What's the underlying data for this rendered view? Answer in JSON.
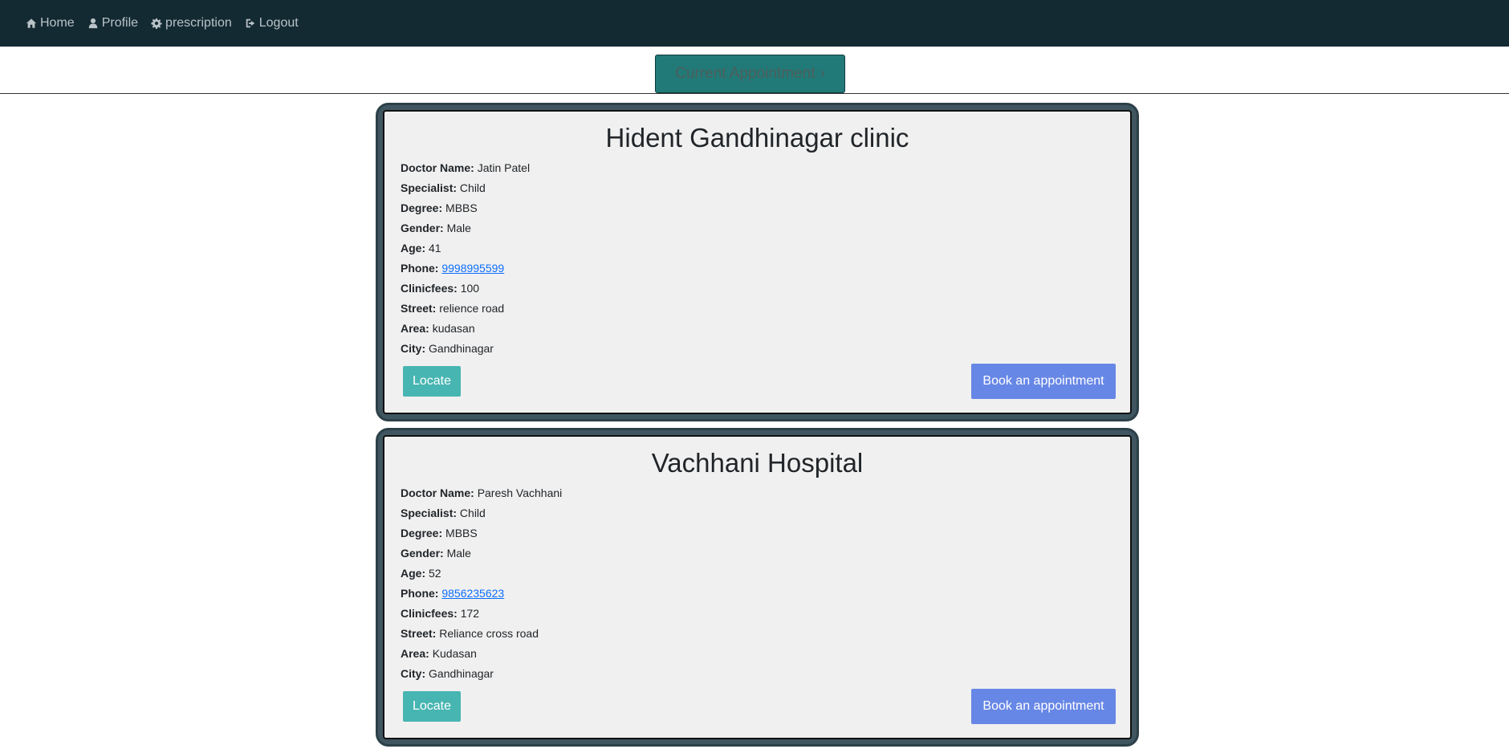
{
  "nav": {
    "items": [
      {
        "label": "Home",
        "icon": "home-icon"
      },
      {
        "label": "Profile",
        "icon": "user-icon"
      },
      {
        "label": "prescription",
        "icon": "gear-icon"
      },
      {
        "label": "Logout",
        "icon": "logout-icon"
      }
    ]
  },
  "current_appointment": {
    "label": "Current Appointment",
    "icon": "chevron-right-icon"
  },
  "labels": {
    "doctor_name": "Doctor Name:",
    "specialist": "Specialist:",
    "degree": "Degree:",
    "gender": "Gender:",
    "age": "Age:",
    "phone": "Phone:",
    "clinicfees": "Clinicfees:",
    "street": "Street:",
    "area": "Area:",
    "city": "City:"
  },
  "clinics": [
    {
      "name": "Hident Gandhinagar clinic",
      "doctor_name": "Jatin Patel",
      "specialist": "Child",
      "degree": "MBBS",
      "gender": "Male",
      "age": "41",
      "phone": "9998995599",
      "clinicfees": "100",
      "street": "relience road",
      "area": "kudasan",
      "city": "Gandhinagar",
      "locate_label": "Locate",
      "book_label": "Book an appointment"
    },
    {
      "name": "Vachhani Hospital",
      "doctor_name": "Paresh Vachhani",
      "specialist": "Child",
      "degree": "MBBS",
      "gender": "Male",
      "age": "52",
      "phone": "9856235623",
      "clinicfees": "172",
      "street": "Reliance cross road",
      "area": "Kudasan",
      "city": "Gandhinagar",
      "locate_label": "Locate",
      "book_label": "Book an appointment"
    }
  ],
  "colors": {
    "navbar": "#142a33",
    "nav_text": "#b9c3c8",
    "current_button": "#217a78",
    "card_border": "#3f5660",
    "card_bg": "#f0f0f0",
    "locate_button": "#47b5b1",
    "book_button": "#6787e6",
    "link": "#0d6efd"
  }
}
